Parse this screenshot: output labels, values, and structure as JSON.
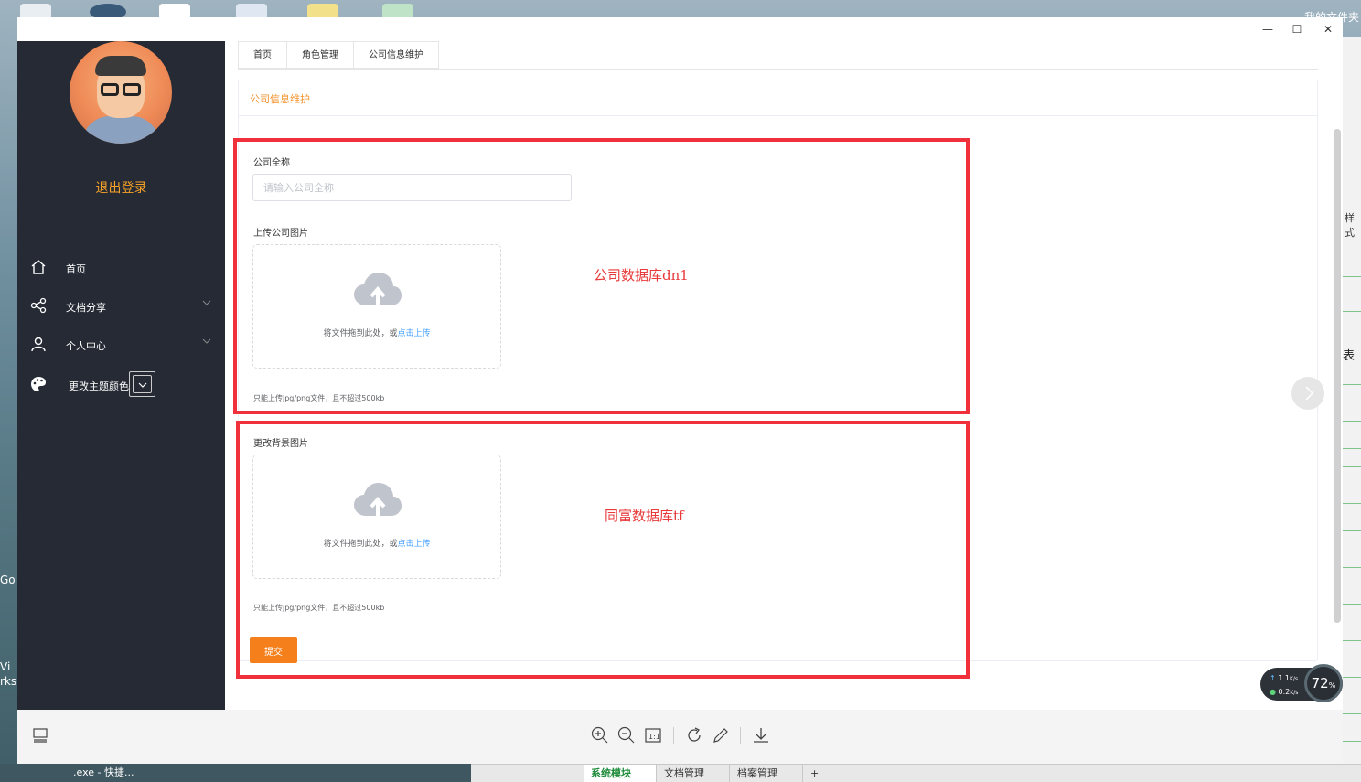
{
  "desktop": {
    "top_right_text": "我的文件夹",
    "left_labels": [
      "Go",
      "Vi",
      "rks"
    ],
    "taskbar_item": ".exe - 快捷..."
  },
  "window": {
    "minimize": "—",
    "maximize": "☐",
    "close": "✕"
  },
  "sidebar": {
    "logout": "退出登录",
    "items": [
      {
        "label": "首页",
        "icon": "home-icon",
        "has_chevron": false
      },
      {
        "label": "文档分享",
        "icon": "share-icon",
        "has_chevron": true
      },
      {
        "label": "个人中心",
        "icon": "user-icon",
        "has_chevron": true
      },
      {
        "label": "更改主题颜色",
        "icon": "palette-icon",
        "has_chevron": false
      }
    ]
  },
  "tabs": [
    "首页",
    "角色管理",
    "公司信息维护"
  ],
  "card": {
    "title": "公司信息维护",
    "company_name_label": "公司全称",
    "company_name_placeholder": "请输入公司全称",
    "company_name_value": "",
    "upload_company_label": "上传公司图片",
    "upload_bg_label": "更改背景图片",
    "dropzone_text": "将文件拖到此处，或",
    "dropzone_link": "点击上传",
    "tip": "只能上传jpg/png文件，且不超过500kb",
    "submit": "提交"
  },
  "annotations": {
    "box1_text": "公司数据库dn1",
    "box2_text": "同富数据库tf",
    "color": "#f0303a"
  },
  "net_widget": {
    "up": "1.1",
    "down": "0.2",
    "unit": "K/s",
    "percent": "72",
    "percent_sign": "%"
  },
  "excel": {
    "sheet_tabs": [
      "系统模块",
      "文档管理",
      "档案管理"
    ],
    "active_tab": "系统模块",
    "add": "+",
    "right_text_1": "样式",
    "right_text_2": "表"
  },
  "colors": {
    "sidebar_bg": "#252a34",
    "accent_orange": "#f3922b",
    "logout_orange": "#f7a128",
    "link_blue": "#409eff",
    "submit_bg": "#f47f1b"
  }
}
